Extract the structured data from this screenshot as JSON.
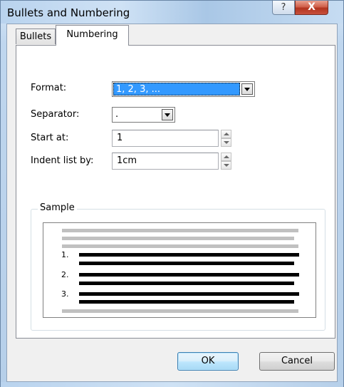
{
  "window": {
    "title": "Bullets and Numbering",
    "help_label": "?",
    "close_label": "X"
  },
  "tabs": [
    {
      "label": "Bullets",
      "active": false
    },
    {
      "label": "Numbering",
      "active": true
    }
  ],
  "form": {
    "format_label": "Format:",
    "format_value": "1, 2, 3, ...",
    "separator_label": "Separator:",
    "separator_value": ".",
    "start_label": "Start at:",
    "start_value": "1",
    "indent_label": "Indent list by:",
    "indent_value": "1cm"
  },
  "sample": {
    "group_label": "Sample",
    "numbers": [
      "1.",
      "2.",
      "3."
    ],
    "colors": {
      "text_line": "#000000",
      "context_line": "#c0c0c0"
    }
  },
  "buttons": {
    "ok": "OK",
    "cancel": "Cancel"
  },
  "colors": {
    "selection": "#3399ff",
    "close_red": "#c7503c"
  }
}
